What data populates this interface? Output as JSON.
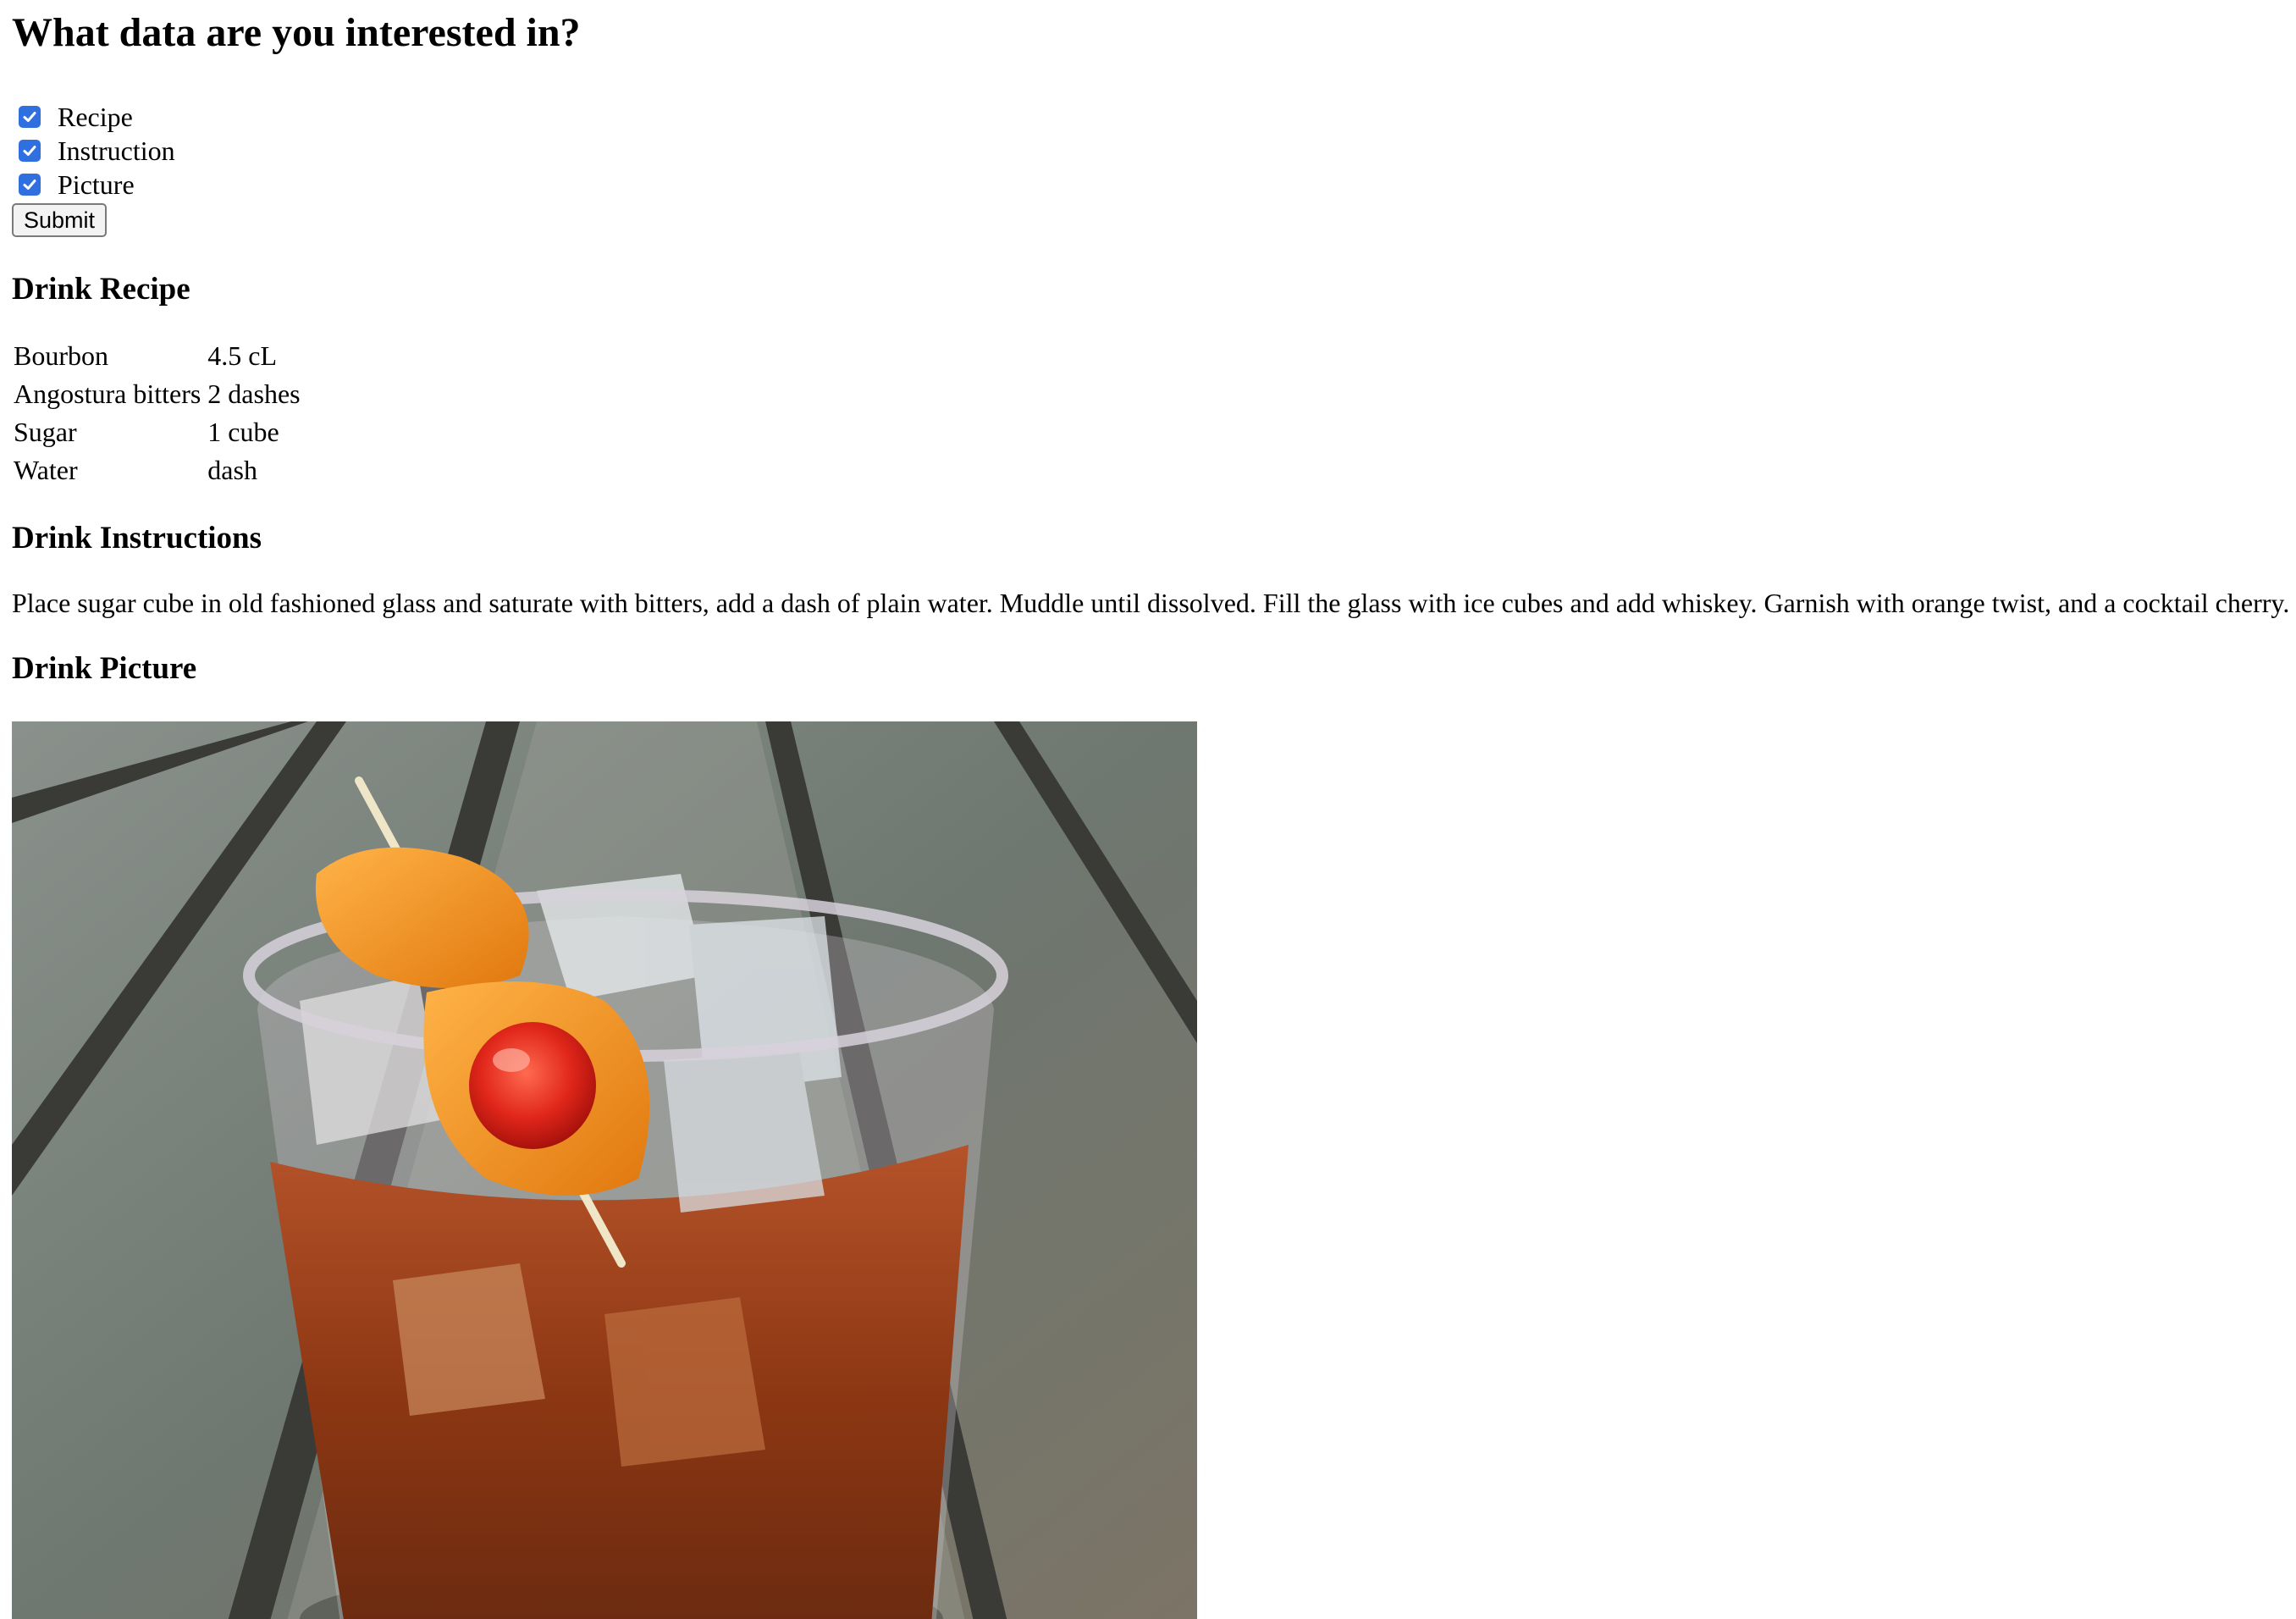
{
  "form": {
    "title": "What data are you interested in?",
    "options": [
      {
        "label": "Recipe",
        "checked": true
      },
      {
        "label": "Instruction",
        "checked": true
      },
      {
        "label": "Picture",
        "checked": true
      }
    ],
    "submit_label": "Submit"
  },
  "recipe": {
    "heading": "Drink Recipe",
    "rows": [
      {
        "ingredient": "Bourbon",
        "amount": "4.5 cL"
      },
      {
        "ingredient": "Angostura bitters",
        "amount": "2 dashes"
      },
      {
        "ingredient": "Sugar",
        "amount": "1 cube"
      },
      {
        "ingredient": "Water",
        "amount": "dash"
      }
    ]
  },
  "instructions": {
    "heading": "Drink Instructions",
    "text": "Place sugar cube in old fashioned glass and saturate with bitters, add a dash of plain water. Muddle until dissolved. Fill the glass with ice cubes and add whiskey. Garnish with orange twist, and a cocktail cherry."
  },
  "picture": {
    "heading": "Drink Picture"
  },
  "colors": {
    "checkbox": "#2f6fe0",
    "drink": "#9a3d16",
    "table_wood": "#6e7770"
  }
}
